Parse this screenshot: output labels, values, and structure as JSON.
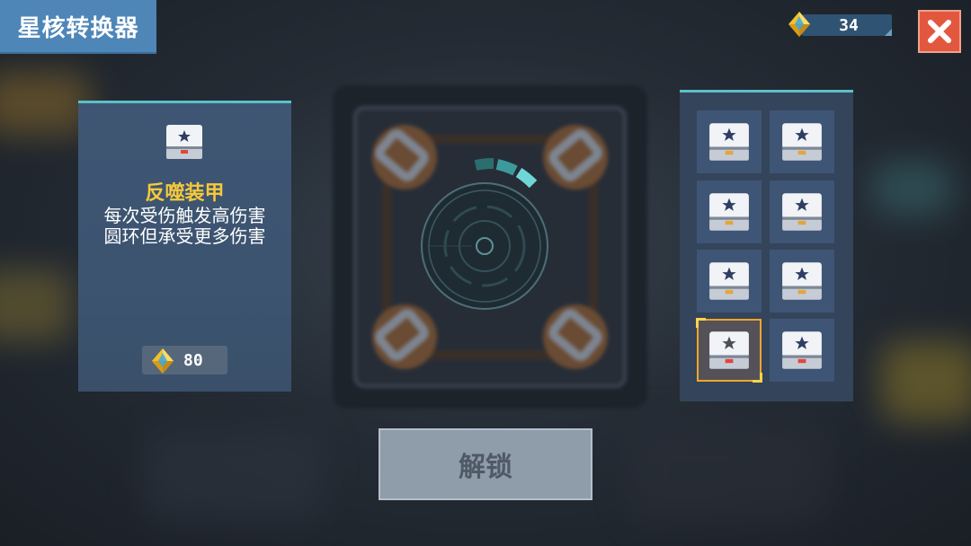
{
  "header": {
    "title": "星核转换器",
    "currency_amount": "34",
    "currency_icon": "gem-icon",
    "close_icon": "close-icon"
  },
  "item_detail": {
    "name": "反噬装甲",
    "description": "每次受伤触发高伤害\n圆环但承受更多伤害",
    "price": "80",
    "name_color": "#f6c93b"
  },
  "inventory": {
    "slots": [
      {
        "icon": "chest-icon",
        "accent": "#e3a63a",
        "selected": false
      },
      {
        "icon": "chest-icon",
        "accent": "#e3a63a",
        "selected": false
      },
      {
        "icon": "chest-icon",
        "accent": "#e3a63a",
        "selected": false
      },
      {
        "icon": "chest-icon",
        "accent": "#e3a63a",
        "selected": false
      },
      {
        "icon": "chest-icon",
        "accent": "#e3a63a",
        "selected": false
      },
      {
        "icon": "chest-icon",
        "accent": "#e3a63a",
        "selected": false
      },
      {
        "icon": "chest-icon",
        "accent": "#e2453a",
        "selected": true
      },
      {
        "icon": "chest-icon",
        "accent": "#e2453a",
        "selected": false
      }
    ]
  },
  "actions": {
    "unlock_label": "解锁"
  },
  "colors": {
    "accent_teal": "#59c1c8",
    "title_bg": "#4f86b8",
    "close_bg": "#e2583f",
    "selected_border": "#f0a62a"
  }
}
